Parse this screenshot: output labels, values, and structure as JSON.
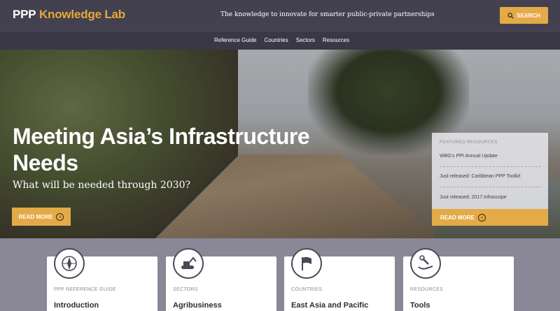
{
  "header": {
    "logo_part1": "PPP",
    "logo_part2": "Knowledge Lab",
    "tagline": "The knowledge to innovate for smarter public-private partnerships",
    "search_label": "SEARCH"
  },
  "nav": {
    "items": [
      {
        "label": "Reference Guide"
      },
      {
        "label": "Countries"
      },
      {
        "label": "Sectors"
      },
      {
        "label": "Resources"
      }
    ]
  },
  "hero": {
    "title_line1": "Meeting Asia’s Infrastructure",
    "title_line2": "Needs",
    "subtitle": "What will be needed through 2030?",
    "read_more": "READ MORE"
  },
  "featured": {
    "heading": "FEATURED RESOURCES",
    "items": [
      {
        "label": "WBG’s PPI Annual Update"
      },
      {
        "label": "Just released: Caribbean PPP Toolkit"
      },
      {
        "label": "Just released: 2017 Infrascope"
      }
    ],
    "read_more": "READ MORE"
  },
  "cards": [
    {
      "label": "PPP REFERENCE GUIDE",
      "title": "Introduction",
      "icon": "compass-icon"
    },
    {
      "label": "SECTORS",
      "title": "Agribusiness",
      "icon": "excavator-icon"
    },
    {
      "label": "COUNTRIES",
      "title": "East Asia and Pacific",
      "icon": "flag-icon"
    },
    {
      "label": "RESOURCES",
      "title": "Tools",
      "icon": "wrench-hand-icon"
    }
  ],
  "colors": {
    "header_bg": "#434150",
    "accent": "#e3aa47",
    "cards_bg": "#8a8796"
  }
}
